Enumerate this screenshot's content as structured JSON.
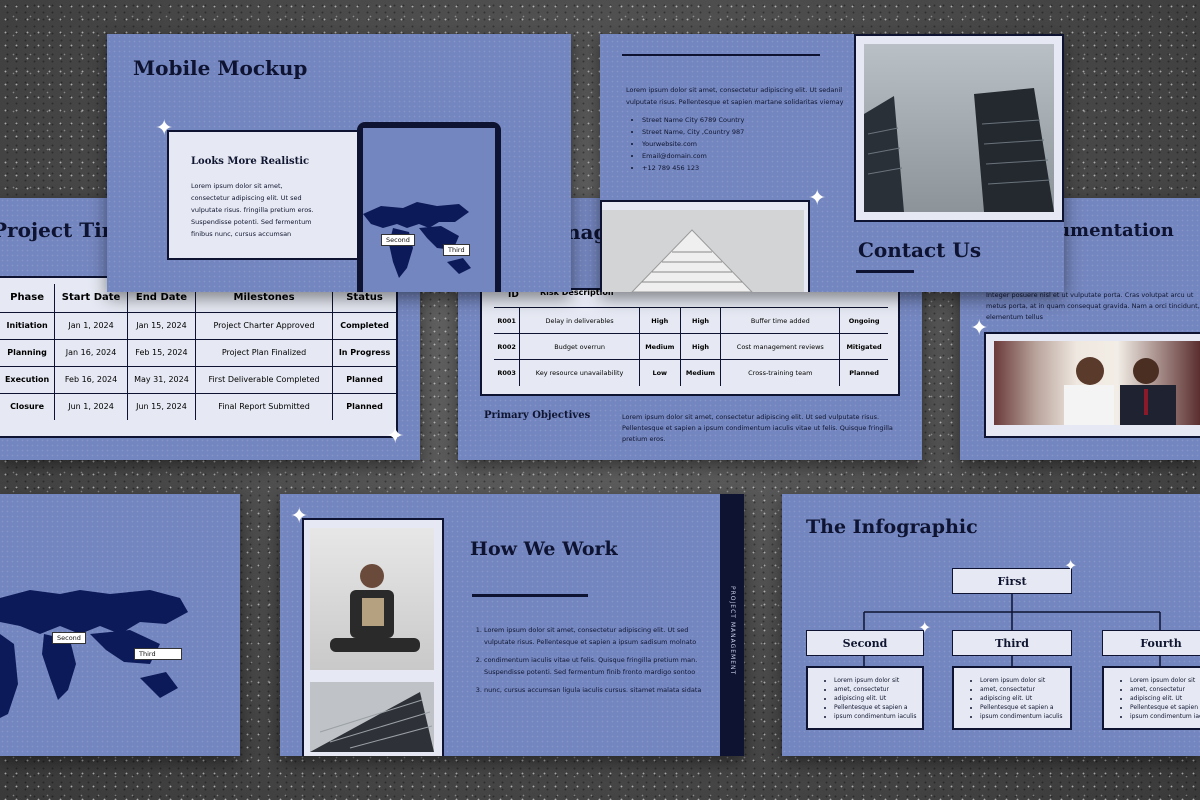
{
  "mockup": {
    "title": "Mobile Mockup",
    "panel_heading": "Looks More Realistic",
    "panel_body": "Lorem ipsum dolor sit amet, consectetur adipiscing elit. Ut sed vulputate risus. fringilla pretium eros. Suspendisse potenti. Sed fermentum finibus nunc, cursus accumsan",
    "map_labels": [
      "Second",
      "Third"
    ]
  },
  "contact": {
    "title": "Contact Us",
    "intro": "Lorem ipsum dolor sit amet, consectetur adipiscing elit. Ut sedanil vulputate risus. Pellentesque et sapien martane solidaritas viemay",
    "items": [
      "Street Name City 6789 Country",
      "Street Name, City ,Country 987",
      "Yourwebsite.com",
      "Email@domain.com",
      "+12 789 456 123"
    ]
  },
  "timeline": {
    "title": "Project Time",
    "headers": [
      "Phase",
      "Start Date",
      "End Date",
      "Milestones",
      "Status"
    ],
    "rows": [
      [
        "Initiation",
        "Jan 1, 2024",
        "Jan 15, 2024",
        "Project Charter Approved",
        "Completed"
      ],
      [
        "Planning",
        "Jan 16, 2024",
        "Feb 15, 2024",
        "Project Plan Finalized",
        "In Progress"
      ],
      [
        "Execution",
        "Feb 16, 2024",
        "May 31, 2024",
        "First Deliverable Completed",
        "Planned"
      ],
      [
        "Closure",
        "Jun 1, 2024",
        "Jun 15, 2024",
        "Final Report Submitted",
        "Planned"
      ]
    ]
  },
  "risk": {
    "title_fragment": "nag",
    "headers": [
      "ID",
      "Risk Description"
    ],
    "rows": [
      [
        "R001",
        "Delay in deliverables",
        "High",
        "High",
        "Buffer time added",
        "Ongoing"
      ],
      [
        "R002",
        "Budget overrun",
        "Medium",
        "High",
        "Cost management reviews",
        "Mitigated"
      ],
      [
        "R003",
        "Key resource unavailability",
        "Low",
        "Medium",
        "Cross-training team",
        "Planned"
      ]
    ],
    "objectives_heading": "Primary Objectives",
    "objectives_text": "Lorem ipsum dolor sit amet, consectetur adipiscing elit. Ut sed vulputate risus. Pellentesque et sapien a ipsum condimentum iaculis vitae ut felis. Quisque fringilla pretium eros."
  },
  "documentation": {
    "title": "cumentation",
    "text": "Integer posuere nisl et ut vulputate porta. Cras volutpat arcu ut metus porta, at in quam consequat gravida. Nam a orci tincidunt, elementum tellus"
  },
  "map_slide": {
    "labels": [
      "Second",
      "Third"
    ]
  },
  "how": {
    "title": "How We Work",
    "side_label": "PROJECT MANAGEMENT",
    "steps": [
      "Lorem ipsum dolor sit amet, consectetur adipiscing elit. Ut sed vulputate risus. Pellentesque et sapien a ipsum sadisum molnato",
      "condimentum iaculis vitae ut felis. Quisque fringilla pretium man. Suspendisse potenti. Sed fermentum finib fronto mardigo sontoo",
      "nunc, cursus accumsan ligula iaculis cursus. sitamet malata sidata"
    ]
  },
  "infographic": {
    "title": "The Infographic",
    "top": "First",
    "nodes": [
      "Second",
      "Third",
      "Fourth"
    ],
    "bullets": [
      "Lorem ipsum dolor sit",
      "amet, consectetur",
      "adipiscing elit. Ut",
      "Pellentesque et sapien a",
      "ipsum condimentum iaculis"
    ]
  },
  "colors": {
    "slide": "#7486bf",
    "ink": "#0d1330",
    "panel": "#e6e9f3"
  }
}
